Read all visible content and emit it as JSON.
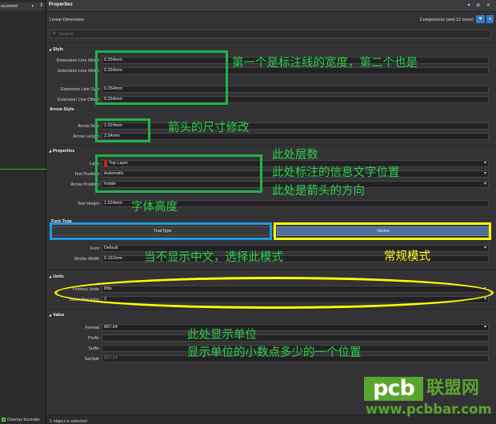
{
  "left": {
    "doc_tab": "ocument",
    "doc_tab_arrow": "▾",
    "overlay_label": "Overlay boundar"
  },
  "panel": {
    "title": "Properties",
    "window_controls": "▾ ⊕ ✕",
    "object_type": "Linear Dimension",
    "components_filter": "Components (and 12 more)",
    "search_placeholder": "Search",
    "status": "1 object is selected"
  },
  "style": {
    "header": "Style",
    "dimension_line_width": {
      "label": "Dimension Line Width",
      "value": "0.254mm"
    },
    "extension_line_width": {
      "label": "Extension Line Width",
      "value": "0.254mm"
    },
    "extension_line_gap": {
      "label": "Extension Line Gap",
      "value": "0.254mm"
    },
    "extension_line_offset": {
      "label": "Extension Line Offset",
      "value": "0.254mm"
    }
  },
  "arrow_style": {
    "header": "Arrow Style",
    "arrow_size": {
      "label": "Arrow Size",
      "value": "1.524mm"
    },
    "arrow_length": {
      "label": "Arrow Length",
      "value": "2.54mm"
    }
  },
  "properties": {
    "header": "Properties",
    "layer": {
      "label": "Laye",
      "value": "Top Layer",
      "swatch_color": "#d02020"
    },
    "text_position": {
      "label": "Text Position",
      "value": "Automatic"
    },
    "arrow_position": {
      "label": "Arrow Position",
      "value": "Inside"
    },
    "text_height": {
      "label": "Text Height",
      "value": "1.524mm"
    }
  },
  "font_type": {
    "header": "Font Type",
    "truetype_label": "TrueType",
    "stroke_label": "Stroke",
    "font": {
      "label": "Font",
      "value": "Default"
    },
    "stroke_width": {
      "label": "Stroke Width",
      "value": "0.152mm"
    }
  },
  "units": {
    "header": "Units",
    "primary_units": {
      "label": "Primary Units",
      "value": "Mils"
    },
    "value_precision": {
      "label": "Value Precision",
      "value": "2"
    }
  },
  "value": {
    "header": "Value",
    "format": {
      "label": "Format",
      "value": "897.64"
    },
    "prefix": {
      "label": "Prefix",
      "value": ""
    },
    "suffix": {
      "label": "Suffix",
      "value": ""
    },
    "sample": {
      "label": "Sample",
      "value": "897.64"
    }
  },
  "annotations": {
    "line_width_note": "第一个是标注线的宽度，第二个也是",
    "arrow_size_note": "箭头的尺寸修改",
    "layer_note": "此处层数",
    "text_position_note": "此处标注的信息文字位置",
    "arrow_direction_note": "此处是箭头的方向",
    "text_height_note": "字体高度",
    "truetype_note": "当不显示中文，选择此模式",
    "stroke_note": "常规模式",
    "units_note": "此处显示单位",
    "precision_note": "显示单位的小数点多少的一个位置"
  },
  "watermark": {
    "logo": "pcb",
    "cn": "联盟网",
    "url": "www.pcbbar.com"
  },
  "colors": {
    "annotation_green": "#22b24a",
    "annotation_blue": "#1e9be0",
    "annotation_yellow": "#ffff00",
    "stroke_button": "#4f6f99",
    "watermark_green": "#5aa52c"
  }
}
